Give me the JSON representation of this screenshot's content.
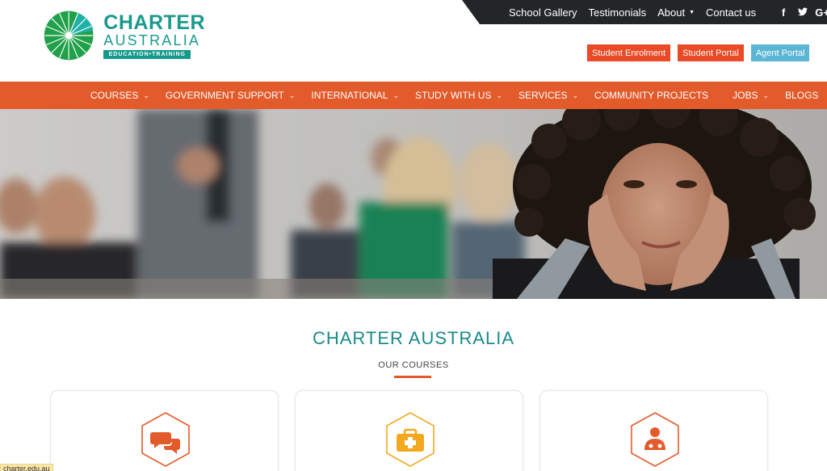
{
  "logo": {
    "line1": "CHARTER",
    "line2": "AUSTRALIA",
    "tagline": "EDUCATION•TRAINING"
  },
  "topbar": {
    "links": [
      "School Gallery",
      "Testimonials",
      "About",
      "Contact us"
    ],
    "social": [
      {
        "icon": "facebook-icon",
        "glyph": "f"
      },
      {
        "icon": "twitter-icon",
        "glyph": "t"
      },
      {
        "icon": "google-plus-icon",
        "glyph": "G+"
      }
    ]
  },
  "portals": {
    "student_enrolment": "Student Enrolment",
    "student_portal": "Student Portal",
    "agent_portal": "Agent Portal"
  },
  "nav": {
    "items": [
      {
        "label": "COURSES",
        "dropdown": true
      },
      {
        "label": "GOVERNMENT SUPPORT",
        "dropdown": true
      },
      {
        "label": "INTERNATIONAL",
        "dropdown": true
      },
      {
        "label": "STUDY WITH US",
        "dropdown": true
      },
      {
        "label": "SERVICES",
        "dropdown": true
      },
      {
        "label": "COMMUNITY PROJECTS",
        "dropdown": false
      },
      {
        "label": "JOBS",
        "dropdown": true
      },
      {
        "label": "BLOGS",
        "dropdown": false
      }
    ]
  },
  "section": {
    "title": "CHARTER AUSTRALIA",
    "subtitle": "OUR COURSES"
  },
  "cards": [
    {
      "icon": "chat-bubbles-icon",
      "color": "#e35a2b"
    },
    {
      "icon": "first-aid-kit-icon",
      "color": "#f2a91f"
    },
    {
      "icon": "doctor-icon",
      "color": "#e35a2b"
    }
  ],
  "status_url": "charter.edu.au",
  "colors": {
    "brand_teal": "#1a9a8c",
    "nav_orange": "#e35a2b",
    "topbar_dark": "#222629",
    "agent_blue": "#5bb5d4"
  }
}
